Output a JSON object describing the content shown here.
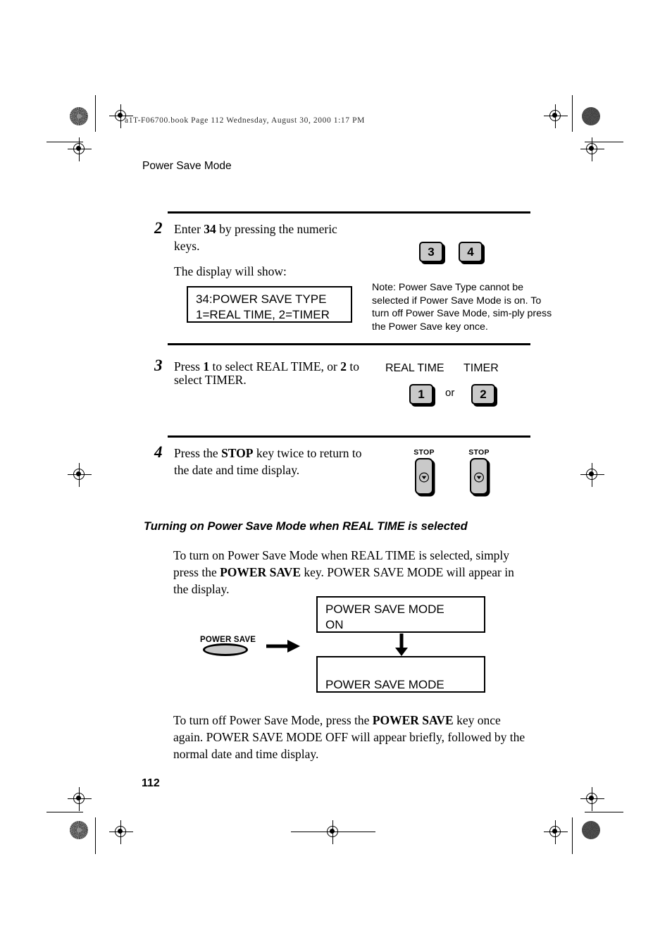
{
  "page": {
    "file_header": "a1T-F06700.book  Page 112  Wednesday, August 30, 2000  1:17 PM",
    "running_head": "Power Save Mode",
    "page_number": "112"
  },
  "steps": [
    {
      "number": "2",
      "text_line1_pre": "Enter ",
      "text_line1_bold": "34",
      "text_line1_post": " by pressing the numeric",
      "text_line2": "keys.",
      "text_line3": "The display will show:",
      "display": {
        "line1": "34:POWER SAVE TYPE",
        "line2": "1=REAL TIME, 2=TIMER"
      },
      "keys": [
        "3",
        "4"
      ],
      "note": "Note: Power Save Type cannot be selected if Power Save Mode is on. To turn off Power Save Mode, sim-ply press the Power Save key once."
    },
    {
      "number": "3",
      "text_pre": "Press ",
      "text_b1": "1",
      "text_mid": " to select REAL TIME, or ",
      "text_b2": "2",
      "text_post": " to",
      "text_line2": "select TIMER.",
      "caption_left": "REAL TIME",
      "caption_right": "TIMER",
      "key_left": "1",
      "or_label": "or",
      "key_right": "2"
    },
    {
      "number": "4",
      "text_pre": "Press the ",
      "text_bold": "STOP",
      "text_post": " key twice to return to",
      "text_line2": "the date and time display.",
      "stop_label_1": "STOP",
      "stop_label_2": "STOP"
    }
  ],
  "section": {
    "heading": "Turning on Power Save Mode when REAL TIME is selected",
    "paragraph1": {
      "pre": "To turn on Power Save Mode when REAL TIME is selected, simply press the ",
      "bold": "POWER SAVE",
      "post": " key. POWER SAVE MODE will appear in the display."
    },
    "paragraph2": {
      "pre": "To turn off Power Save Mode, press the ",
      "bold": "POWER SAVE",
      "post": " key once again. POWER SAVE MODE OFF will appear briefly, followed by the normal date and time display."
    },
    "power_save_key_label": "POWER SAVE",
    "display_top": {
      "line1": "POWER SAVE MODE",
      "line2": "ON"
    },
    "display_bottom": {
      "line1": "",
      "line2": "POWER SAVE MODE"
    }
  },
  "icons": {
    "stop_glyph": "circle-down-triangle-icon",
    "arrow_right": "arrow-right-icon",
    "arrow_down": "arrow-down-icon",
    "registration_mark": "registration-target-icon",
    "halftone_dot": "halftone-dot-icon"
  }
}
